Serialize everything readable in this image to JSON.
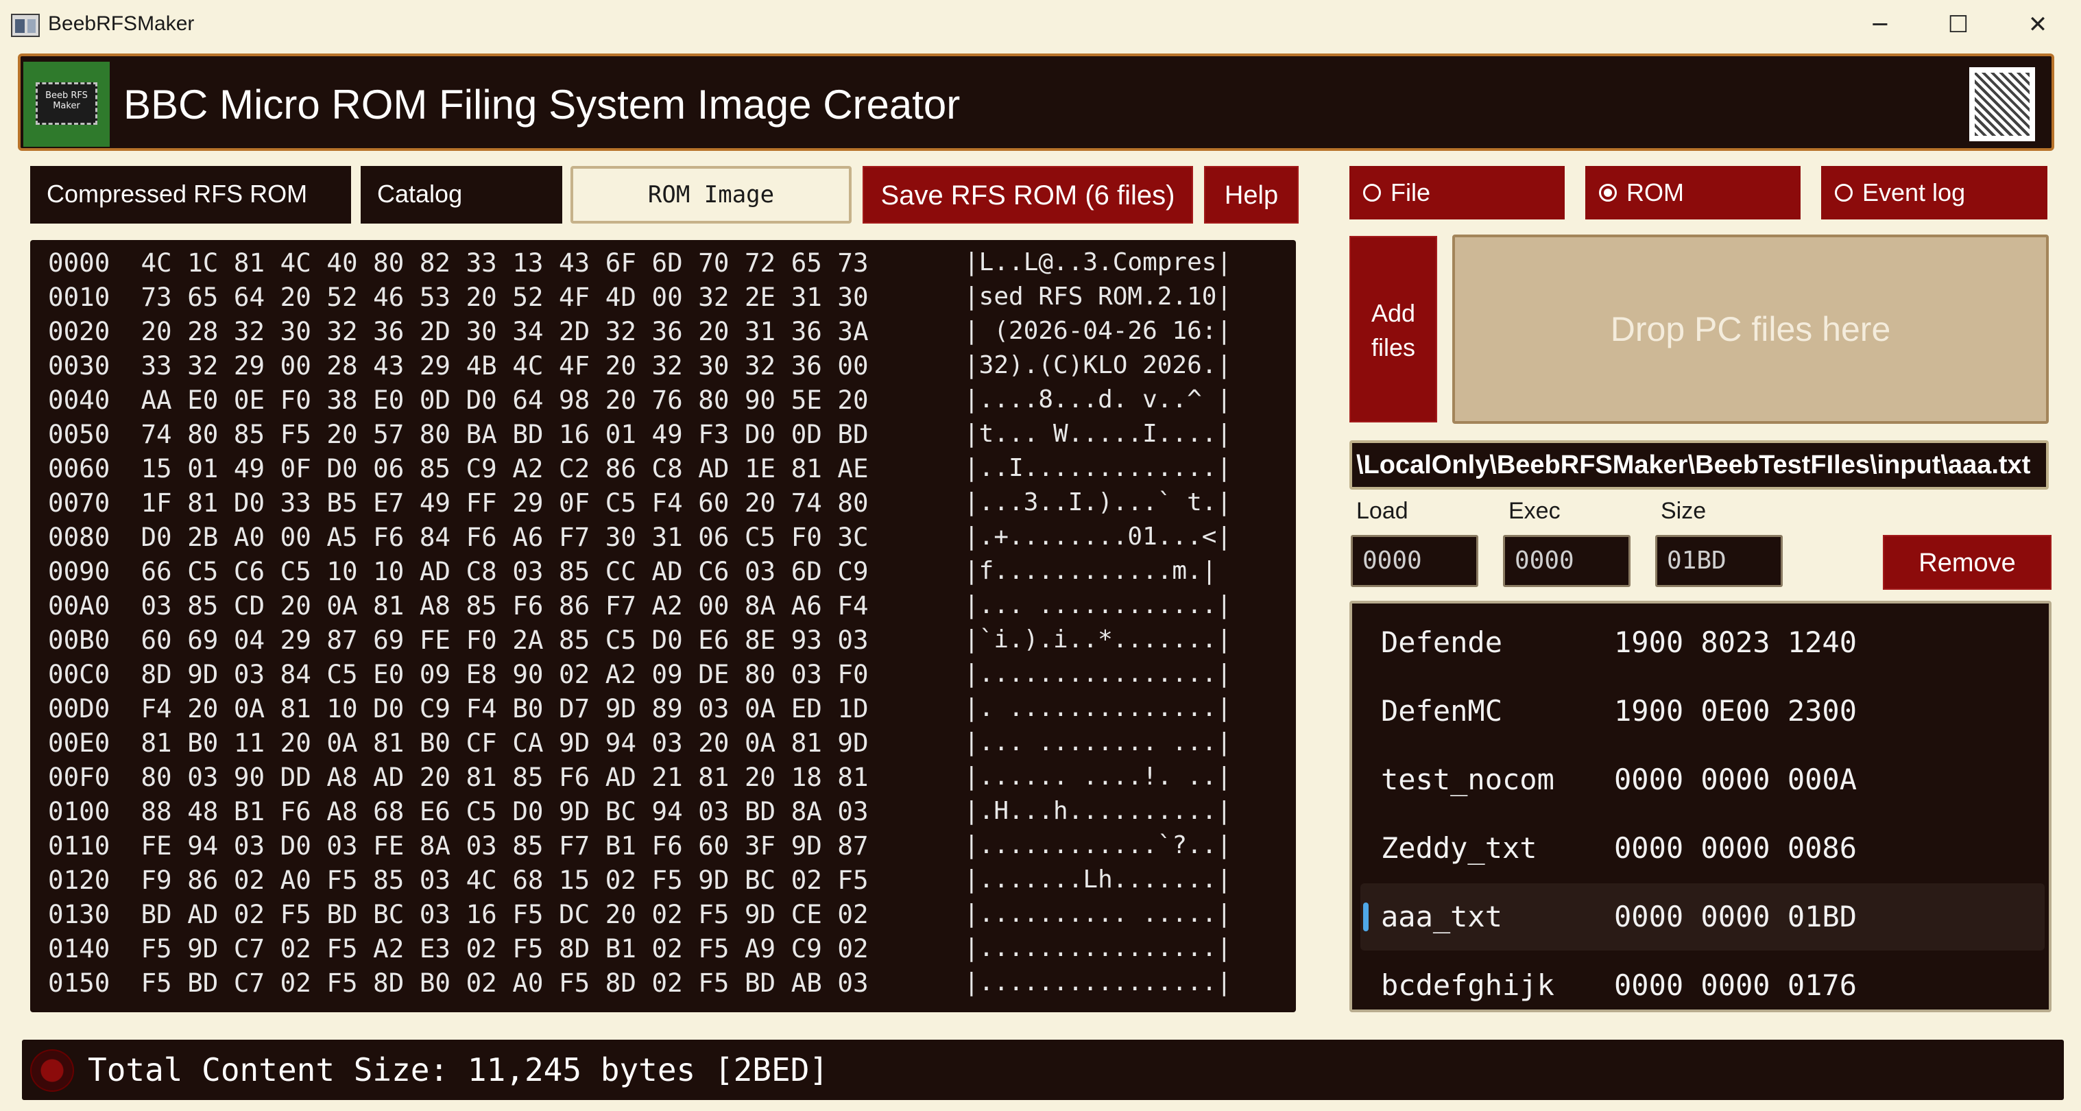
{
  "window": {
    "title": "BeebRFSMaker",
    "minimize_glyph": "─",
    "maximize_glyph": "☐",
    "close_glyph": "✕"
  },
  "header": {
    "title": "BBC Micro ROM Filing System Image Creator",
    "logo_text": "Beeb RFS Maker"
  },
  "tabs": {
    "compressed": "Compressed RFS ROM",
    "catalog": "Catalog",
    "rom_image": "ROM Image"
  },
  "buttons": {
    "save": "Save RFS ROM (6 files)",
    "help": "Help",
    "add_files": "Add files",
    "remove": "Remove"
  },
  "hex": {
    "rows": [
      {
        "addr": "0000",
        "bytes": "4C 1C 81 4C 40 80 82 33 13 43 6F 6D 70 72 65 73",
        "ascii": "|L..L@..3.Compres|"
      },
      {
        "addr": "0010",
        "bytes": "73 65 64 20 52 46 53 20 52 4F 4D 00 32 2E 31 30",
        "ascii": "|sed RFS ROM.2.10|"
      },
      {
        "addr": "0020",
        "bytes": "20 28 32 30 32 36 2D 30 34 2D 32 36 20 31 36 3A",
        "ascii": "| (2026-04-26 16:|"
      },
      {
        "addr": "0030",
        "bytes": "33 32 29 00 28 43 29 4B 4C 4F 20 32 30 32 36 00",
        "ascii": "|32).(C)KLO 2026.|"
      },
      {
        "addr": "0040",
        "bytes": "AA E0 0E F0 38 E0 0D D0 64 98 20 76 80 90 5E 20",
        "ascii": "|....8...d. v..^ |"
      },
      {
        "addr": "0050",
        "bytes": "74 80 85 F5 20 57 80 BA BD 16 01 49 F3 D0 0D BD",
        "ascii": "|t... W.....I....|"
      },
      {
        "addr": "0060",
        "bytes": "15 01 49 0F D0 06 85 C9 A2 C2 86 C8 AD 1E 81 AE",
        "ascii": "|..I.............|"
      },
      {
        "addr": "0070",
        "bytes": "1F 81 D0 33 B5 E7 49 FF 29 0F C5 F4 60 20 74 80",
        "ascii": "|...3..I.)...` t.|"
      },
      {
        "addr": "0080",
        "bytes": "D0 2B A0 00 A5 F6 84 F6 A6 F7 30 31 06 C5 F0 3C",
        "ascii": "|.+........01...<|"
      },
      {
        "addr": "0090",
        "bytes": "66 C5 C6 C5 10 10 AD C8 03 85 CC AD C6 03 6D C9",
        "ascii": "|f............m.|"
      },
      {
        "addr": "00A0",
        "bytes": "03 85 CD 20 0A 81 A8 85 F6 86 F7 A2 00 8A A6 F4",
        "ascii": "|... ............|"
      },
      {
        "addr": "00B0",
        "bytes": "60 69 04 29 87 69 FE F0 2A 85 C5 D0 E6 8E 93 03",
        "ascii": "|`i.).i..*.......|"
      },
      {
        "addr": "00C0",
        "bytes": "8D 9D 03 84 C5 E0 09 E8 90 02 A2 09 DE 80 03 F0",
        "ascii": "|................|"
      },
      {
        "addr": "00D0",
        "bytes": "F4 20 0A 81 10 D0 C9 F4 B0 D7 9D 89 03 0A ED 1D",
        "ascii": "|. ..............|"
      },
      {
        "addr": "00E0",
        "bytes": "81 B0 11 20 0A 81 B0 CF CA 9D 94 03 20 0A 81 9D",
        "ascii": "|... ........ ...|"
      },
      {
        "addr": "00F0",
        "bytes": "80 03 90 DD A8 AD 20 81 85 F6 AD 21 81 20 18 81",
        "ascii": "|...... ....!. ..|"
      },
      {
        "addr": "0100",
        "bytes": "88 48 B1 F6 A8 68 E6 C5 D0 9D BC 94 03 BD 8A 03",
        "ascii": "|.H...h..........|"
      },
      {
        "addr": "0110",
        "bytes": "FE 94 03 D0 03 FE 8A 03 85 F7 B1 F6 60 3F 9D 87",
        "ascii": "|............`?..|"
      },
      {
        "addr": "0120",
        "bytes": "F9 86 02 A0 F5 85 03 4C 68 15 02 F5 9D BC 02 F5",
        "ascii": "|.......Lh.......|"
      },
      {
        "addr": "0130",
        "bytes": "BD AD 02 F5 BD BC 03 16 F5 DC 20 02 F5 9D CE 02",
        "ascii": "|.......... .....|"
      },
      {
        "addr": "0140",
        "bytes": "F5 9D C7 02 F5 A2 E3 02 F5 8D B1 02 F5 A9 C9 02",
        "ascii": "|................|"
      },
      {
        "addr": "0150",
        "bytes": "F5 BD C7 02 F5 8D B0 02 A0 F5 8D 02 F5 BD AB 03",
        "ascii": "|................|"
      }
    ]
  },
  "mode_radios": [
    {
      "label": "File",
      "selected": false
    },
    {
      "label": "ROM",
      "selected": true
    },
    {
      "label": "Event log",
      "selected": false
    }
  ],
  "drop_area": {
    "text": "Drop PC files here"
  },
  "file_path": "\\LocalOnly\\BeebRFSMaker\\BeebTestFIles\\input\\aaa.txt",
  "fields": {
    "load": {
      "label": "Load",
      "value": "0000"
    },
    "exec": {
      "label": "Exec",
      "value": "0000"
    },
    "size": {
      "label": "Size",
      "value": "01BD"
    }
  },
  "files": [
    {
      "name": "Defende",
      "values": "1900 8023 1240",
      "selected": false
    },
    {
      "name": "DefenMC",
      "values": "1900 0E00 2300",
      "selected": false
    },
    {
      "name": "test_nocom",
      "values": "0000 0000 000A",
      "selected": false
    },
    {
      "name": "Zeddy_txt",
      "values": "0000 0000 0086",
      "selected": false
    },
    {
      "name": "aaa_txt",
      "values": "0000 0000 01BD",
      "selected": true
    },
    {
      "name": "bcdefghijk",
      "values": "0000 0000 0176",
      "selected": false
    }
  ],
  "status": {
    "text": "Total Content Size: 11,245 bytes [2BED]"
  },
  "colors": {
    "dark_panel": "#1d0e0a",
    "accent_red": "#8c0b0b",
    "background": "#f7f2dd",
    "drop_area": "#cdb896",
    "selection_marker": "#4fa8e8"
  }
}
